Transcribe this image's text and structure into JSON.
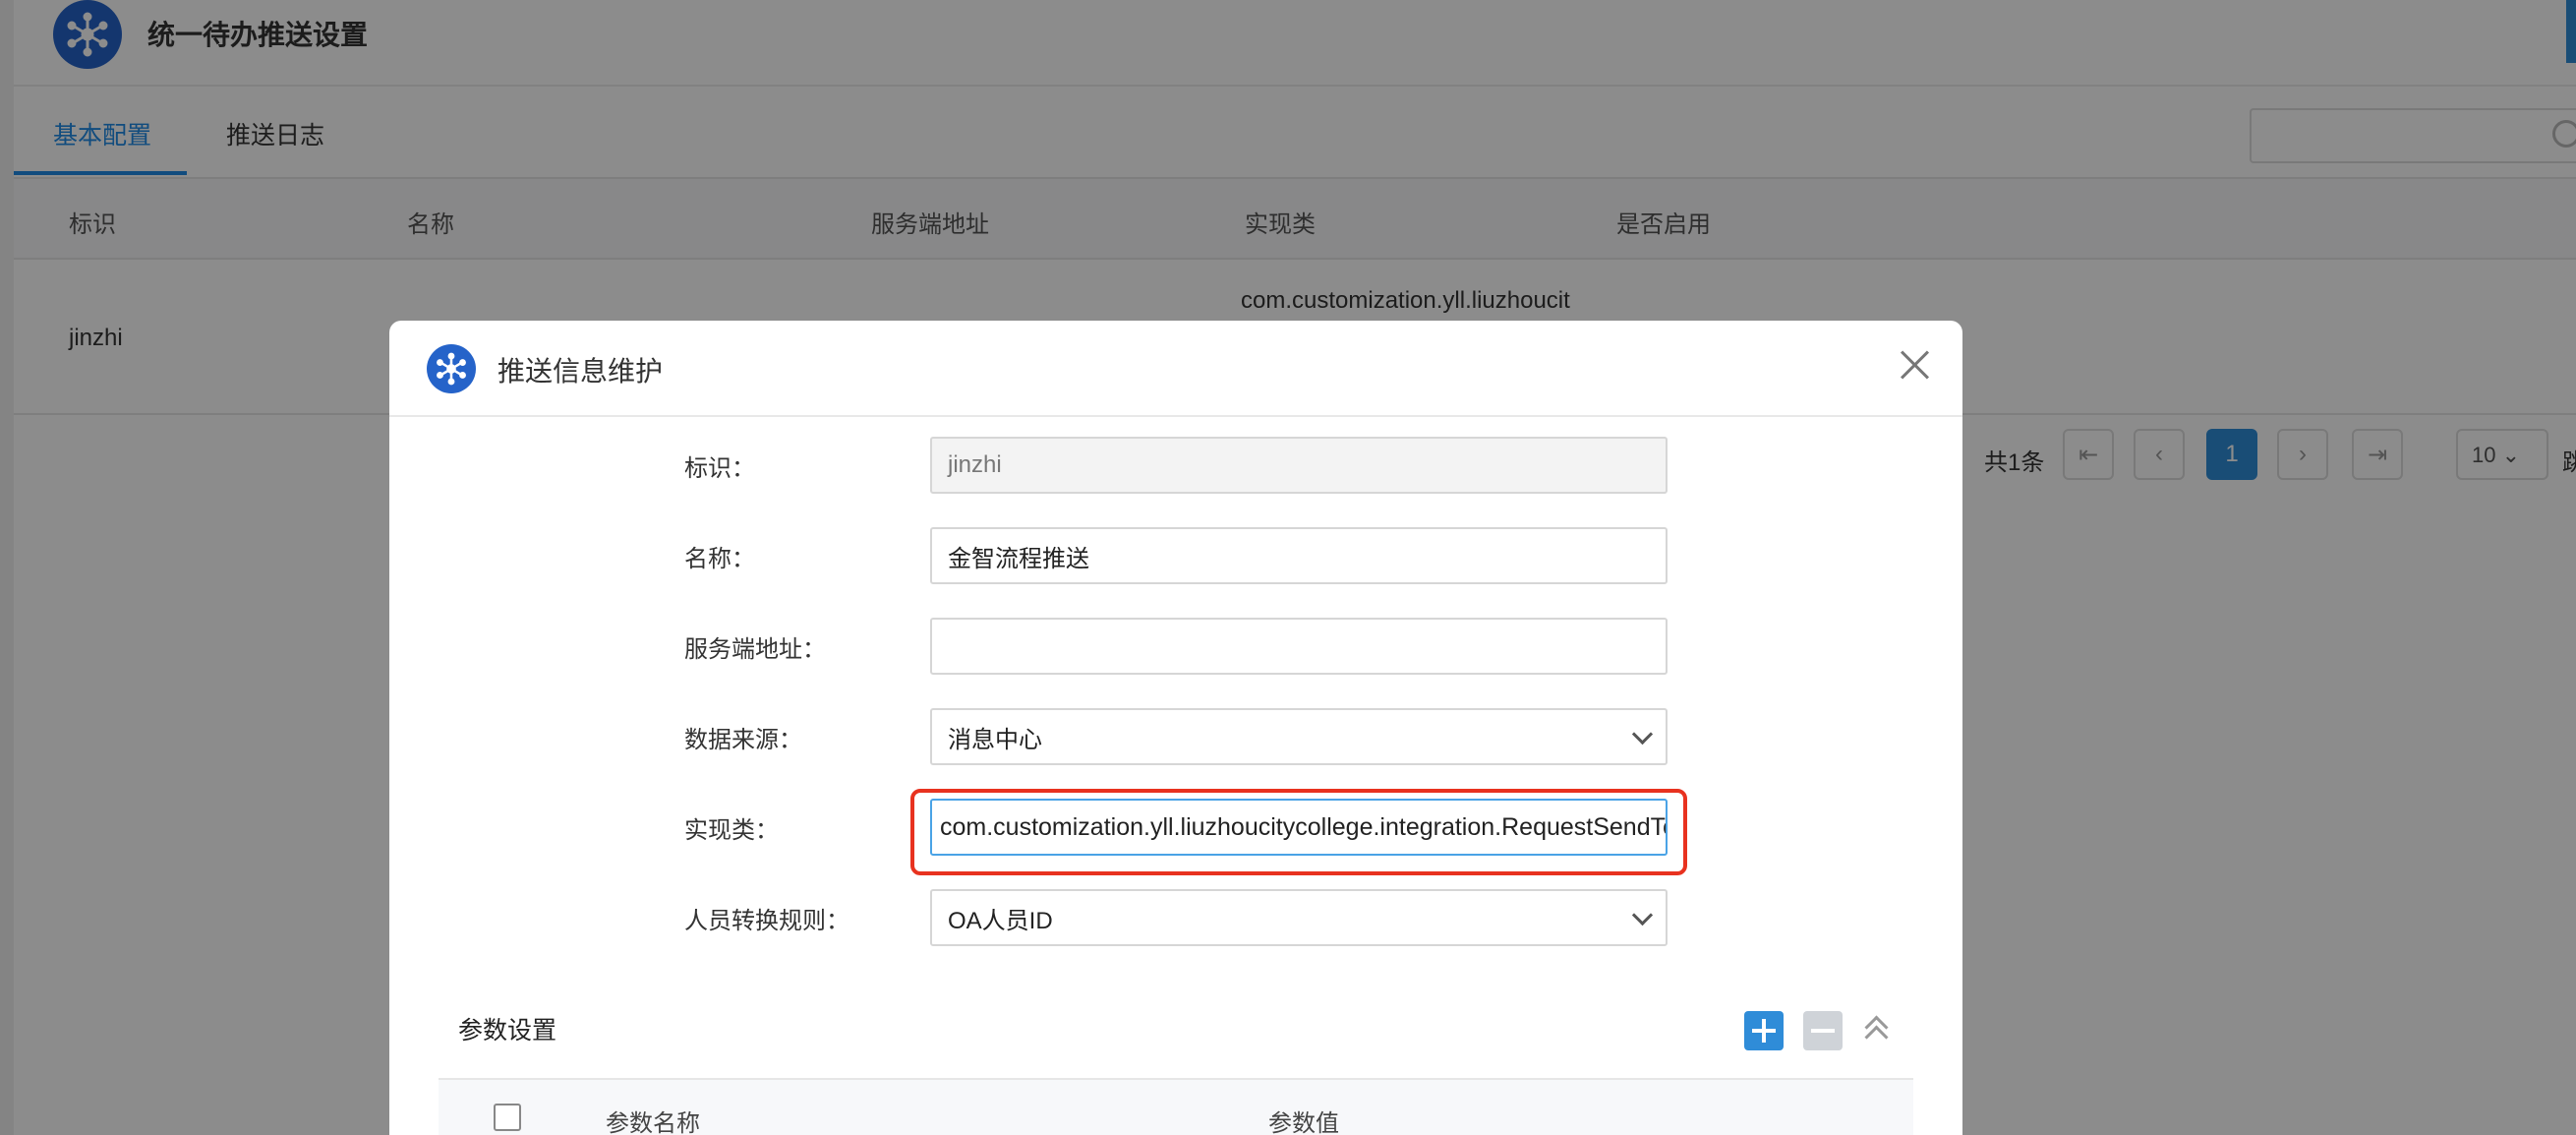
{
  "header": {
    "title": "统一待办推送设置"
  },
  "tabs": [
    {
      "label": "基本配置",
      "active": true
    },
    {
      "label": "推送日志",
      "active": false
    }
  ],
  "table": {
    "columns": [
      "标识",
      "名称",
      "服务端地址",
      "实现类",
      "是否启用"
    ],
    "rows": [
      {
        "id": "jinzhi",
        "impl": "com.customization.yll.liuzhoucit"
      }
    ]
  },
  "pagination": {
    "total": "共1条",
    "current": "1",
    "page_size": "10",
    "jump_label": "跳"
  },
  "modal": {
    "title": "推送信息维护",
    "fields": {
      "id": {
        "label": "标识：",
        "value": "jinzhi"
      },
      "name": {
        "label": "名称：",
        "value": "金智流程推送"
      },
      "server": {
        "label": "服务端地址：",
        "value": ""
      },
      "source": {
        "label": "数据来源：",
        "value": "消息中心"
      },
      "impl": {
        "label": "实现类：",
        "value": "com.customization.yll.liuzhoucitycollege.integration.RequestSendTo"
      },
      "rule": {
        "label": "人员转换规则：",
        "value": "OA人员ID"
      }
    },
    "params": {
      "title": "参数设置",
      "columns": [
        "参数名称",
        "参数值"
      ]
    }
  },
  "colors": {
    "accent": "#2f8cd8",
    "highlight": "#e8321f",
    "logo": "#2563c9"
  }
}
